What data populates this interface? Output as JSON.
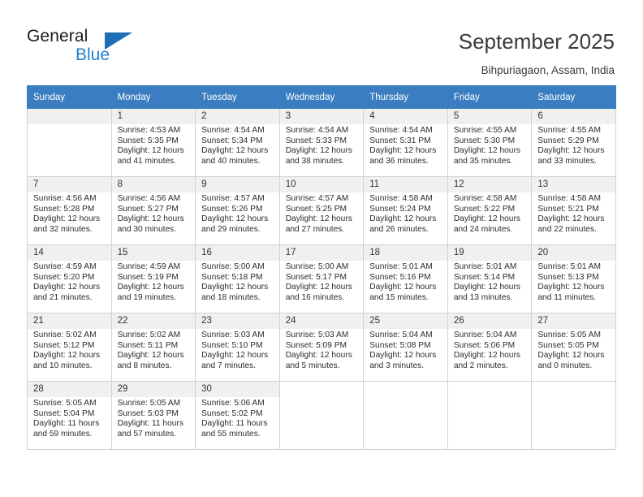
{
  "brand": {
    "name_part1": "General",
    "name_part2": "Blue",
    "triangle_color": "#1f6db5",
    "blue_text_color": "#1f7fd0"
  },
  "header": {
    "title": "September 2025",
    "location": "Bihpuriagaon, Assam, India"
  },
  "theme": {
    "header_row_bg": "#3a7dc0",
    "day_number_bg": "#f0f0f0",
    "grid_border": "#d2d2d2"
  },
  "weekday_headers": [
    "Sunday",
    "Monday",
    "Tuesday",
    "Wednesday",
    "Thursday",
    "Friday",
    "Saturday"
  ],
  "weeks": [
    [
      {
        "day": "",
        "blank": true
      },
      {
        "day": "1",
        "sunrise": "Sunrise: 4:53 AM",
        "sunset": "Sunset: 5:35 PM",
        "daylight_line1": "Daylight: 12 hours",
        "daylight_line2": "and 41 minutes."
      },
      {
        "day": "2",
        "sunrise": "Sunrise: 4:54 AM",
        "sunset": "Sunset: 5:34 PM",
        "daylight_line1": "Daylight: 12 hours",
        "daylight_line2": "and 40 minutes."
      },
      {
        "day": "3",
        "sunrise": "Sunrise: 4:54 AM",
        "sunset": "Sunset: 5:33 PM",
        "daylight_line1": "Daylight: 12 hours",
        "daylight_line2": "and 38 minutes."
      },
      {
        "day": "4",
        "sunrise": "Sunrise: 4:54 AM",
        "sunset": "Sunset: 5:31 PM",
        "daylight_line1": "Daylight: 12 hours",
        "daylight_line2": "and 36 minutes."
      },
      {
        "day": "5",
        "sunrise": "Sunrise: 4:55 AM",
        "sunset": "Sunset: 5:30 PM",
        "daylight_line1": "Daylight: 12 hours",
        "daylight_line2": "and 35 minutes."
      },
      {
        "day": "6",
        "sunrise": "Sunrise: 4:55 AM",
        "sunset": "Sunset: 5:29 PM",
        "daylight_line1": "Daylight: 12 hours",
        "daylight_line2": "and 33 minutes."
      }
    ],
    [
      {
        "day": "7",
        "sunrise": "Sunrise: 4:56 AM",
        "sunset": "Sunset: 5:28 PM",
        "daylight_line1": "Daylight: 12 hours",
        "daylight_line2": "and 32 minutes."
      },
      {
        "day": "8",
        "sunrise": "Sunrise: 4:56 AM",
        "sunset": "Sunset: 5:27 PM",
        "daylight_line1": "Daylight: 12 hours",
        "daylight_line2": "and 30 minutes."
      },
      {
        "day": "9",
        "sunrise": "Sunrise: 4:57 AM",
        "sunset": "Sunset: 5:26 PM",
        "daylight_line1": "Daylight: 12 hours",
        "daylight_line2": "and 29 minutes."
      },
      {
        "day": "10",
        "sunrise": "Sunrise: 4:57 AM",
        "sunset": "Sunset: 5:25 PM",
        "daylight_line1": "Daylight: 12 hours",
        "daylight_line2": "and 27 minutes."
      },
      {
        "day": "11",
        "sunrise": "Sunrise: 4:58 AM",
        "sunset": "Sunset: 5:24 PM",
        "daylight_line1": "Daylight: 12 hours",
        "daylight_line2": "and 26 minutes."
      },
      {
        "day": "12",
        "sunrise": "Sunrise: 4:58 AM",
        "sunset": "Sunset: 5:22 PM",
        "daylight_line1": "Daylight: 12 hours",
        "daylight_line2": "and 24 minutes."
      },
      {
        "day": "13",
        "sunrise": "Sunrise: 4:58 AM",
        "sunset": "Sunset: 5:21 PM",
        "daylight_line1": "Daylight: 12 hours",
        "daylight_line2": "and 22 minutes."
      }
    ],
    [
      {
        "day": "14",
        "sunrise": "Sunrise: 4:59 AM",
        "sunset": "Sunset: 5:20 PM",
        "daylight_line1": "Daylight: 12 hours",
        "daylight_line2": "and 21 minutes."
      },
      {
        "day": "15",
        "sunrise": "Sunrise: 4:59 AM",
        "sunset": "Sunset: 5:19 PM",
        "daylight_line1": "Daylight: 12 hours",
        "daylight_line2": "and 19 minutes."
      },
      {
        "day": "16",
        "sunrise": "Sunrise: 5:00 AM",
        "sunset": "Sunset: 5:18 PM",
        "daylight_line1": "Daylight: 12 hours",
        "daylight_line2": "and 18 minutes."
      },
      {
        "day": "17",
        "sunrise": "Sunrise: 5:00 AM",
        "sunset": "Sunset: 5:17 PM",
        "daylight_line1": "Daylight: 12 hours",
        "daylight_line2": "and 16 minutes."
      },
      {
        "day": "18",
        "sunrise": "Sunrise: 5:01 AM",
        "sunset": "Sunset: 5:16 PM",
        "daylight_line1": "Daylight: 12 hours",
        "daylight_line2": "and 15 minutes."
      },
      {
        "day": "19",
        "sunrise": "Sunrise: 5:01 AM",
        "sunset": "Sunset: 5:14 PM",
        "daylight_line1": "Daylight: 12 hours",
        "daylight_line2": "and 13 minutes."
      },
      {
        "day": "20",
        "sunrise": "Sunrise: 5:01 AM",
        "sunset": "Sunset: 5:13 PM",
        "daylight_line1": "Daylight: 12 hours",
        "daylight_line2": "and 11 minutes."
      }
    ],
    [
      {
        "day": "21",
        "sunrise": "Sunrise: 5:02 AM",
        "sunset": "Sunset: 5:12 PM",
        "daylight_line1": "Daylight: 12 hours",
        "daylight_line2": "and 10 minutes."
      },
      {
        "day": "22",
        "sunrise": "Sunrise: 5:02 AM",
        "sunset": "Sunset: 5:11 PM",
        "daylight_line1": "Daylight: 12 hours",
        "daylight_line2": "and 8 minutes."
      },
      {
        "day": "23",
        "sunrise": "Sunrise: 5:03 AM",
        "sunset": "Sunset: 5:10 PM",
        "daylight_line1": "Daylight: 12 hours",
        "daylight_line2": "and 7 minutes."
      },
      {
        "day": "24",
        "sunrise": "Sunrise: 5:03 AM",
        "sunset": "Sunset: 5:09 PM",
        "daylight_line1": "Daylight: 12 hours",
        "daylight_line2": "and 5 minutes."
      },
      {
        "day": "25",
        "sunrise": "Sunrise: 5:04 AM",
        "sunset": "Sunset: 5:08 PM",
        "daylight_line1": "Daylight: 12 hours",
        "daylight_line2": "and 3 minutes."
      },
      {
        "day": "26",
        "sunrise": "Sunrise: 5:04 AM",
        "sunset": "Sunset: 5:06 PM",
        "daylight_line1": "Daylight: 12 hours",
        "daylight_line2": "and 2 minutes."
      },
      {
        "day": "27",
        "sunrise": "Sunrise: 5:05 AM",
        "sunset": "Sunset: 5:05 PM",
        "daylight_line1": "Daylight: 12 hours",
        "daylight_line2": "and 0 minutes."
      }
    ],
    [
      {
        "day": "28",
        "sunrise": "Sunrise: 5:05 AM",
        "sunset": "Sunset: 5:04 PM",
        "daylight_line1": "Daylight: 11 hours",
        "daylight_line2": "and 59 minutes."
      },
      {
        "day": "29",
        "sunrise": "Sunrise: 5:05 AM",
        "sunset": "Sunset: 5:03 PM",
        "daylight_line1": "Daylight: 11 hours",
        "daylight_line2": "and 57 minutes."
      },
      {
        "day": "30",
        "sunrise": "Sunrise: 5:06 AM",
        "sunset": "Sunset: 5:02 PM",
        "daylight_line1": "Daylight: 11 hours",
        "daylight_line2": "and 55 minutes."
      },
      {
        "day": "",
        "empty": true
      },
      {
        "day": "",
        "empty": true
      },
      {
        "day": "",
        "empty": true
      },
      {
        "day": "",
        "empty": true
      }
    ]
  ]
}
